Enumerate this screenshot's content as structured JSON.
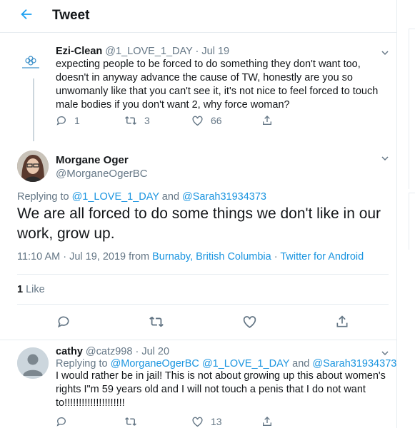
{
  "header": {
    "title": "Tweet"
  },
  "tweet1": {
    "author": "Ezi-Clean",
    "handle": "@1_LOVE_1_DAY",
    "separator": "·",
    "date": "Jul 19",
    "text": "expecting people to be forced to do something they don't want too, doesn't in anyway advance the cause of  TW, honestly are you so unwomanly like that you can't see it, it's not nice to feel forced to touch male bodies if you don't want 2, why force woman?",
    "replies": "1",
    "retweets": "3",
    "likes": "66"
  },
  "tweet2": {
    "author": "Morgane Oger",
    "handle": "@MorganeOgerBC",
    "replying_prefix": "Replying to ",
    "replying_to_1": "@1_LOVE_1_DAY",
    "replying_and": " and ",
    "replying_to_2": "@Sarah31934373",
    "text": "We are all forced to do some things we don't like in our work, grow up.",
    "time": "11:10 AM · Jul 19, 2019 from ",
    "location": "Burnaby, British Columbia",
    "dot": " · ",
    "source": "Twitter for Android",
    "like_count": "1",
    "like_label": " Like"
  },
  "tweet3": {
    "author": "cathy",
    "handle": "@catz998",
    "separator": "·",
    "date": "Jul 20",
    "replying_prefix": "Replying to ",
    "replying_to_1": "@MorganeOgerBC",
    "replying_to_2": "@1_LOVE_1_DAY",
    "replying_and": " and ",
    "replying_to_3": "@Sarah31934373",
    "text": "I would rather be in jail!  This is not about growing up this about women's rights I\"m 59 years old and I will not touch a penis that I do not want to!!!!!!!!!!!!!!!!!!!!!",
    "likes": "13"
  },
  "colors": {
    "accent": "#1da1f2",
    "link": "#1b95e0",
    "muted": "#657786"
  }
}
